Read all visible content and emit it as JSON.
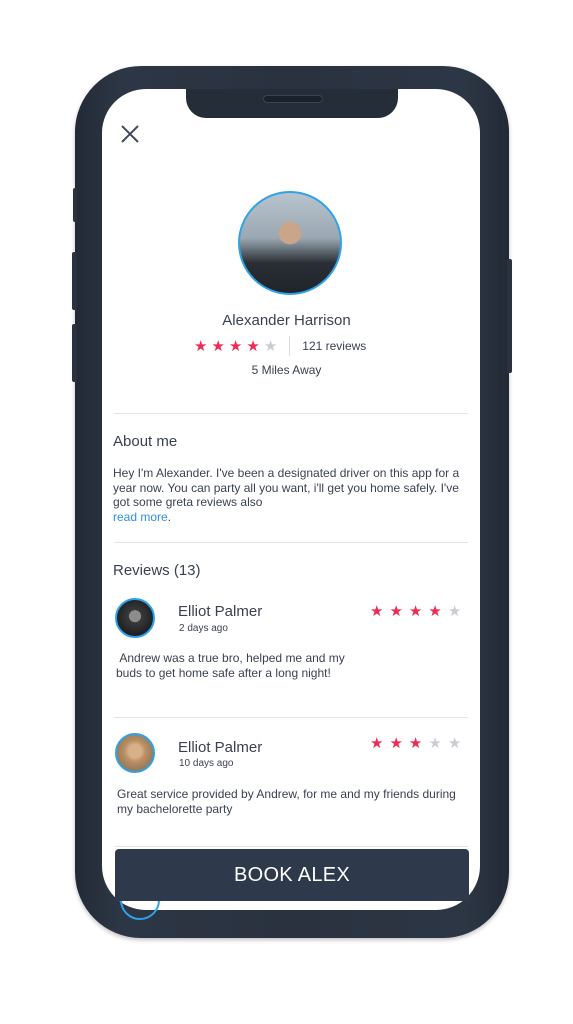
{
  "profile": {
    "name": "Alexander Harrison",
    "rating": 4,
    "rating_max": 5,
    "review_count_label": "121 reviews",
    "distance": "5 Miles Away"
  },
  "about": {
    "title": "About me",
    "text": "Hey I'm Alexander. I've been a designated driver on this app for a year now. You can party all you want, i'll get you home safely. I've got some greta reviews also",
    "read_more": "read more",
    "read_more_suffix": "."
  },
  "reviews": {
    "title": "Reviews (13)",
    "items": [
      {
        "name": "Elliot Palmer",
        "date": "2 days ago",
        "rating": 4,
        "text": " Andrew was a true bro, helped me and my buds to get home safe after a long night!"
      },
      {
        "name": "Elliot Palmer",
        "date": "10 days ago",
        "rating": 3,
        "text": "Great service provided by Andrew, for me and my friends during my bachelorette party"
      }
    ]
  },
  "actions": {
    "close_icon": "close-icon",
    "book_label": "BOOK ALEX"
  },
  "colors": {
    "star_on": "#ee2a55",
    "star_off": "#c9cdd3",
    "accent_blue": "#2fa3e6",
    "link": "#2f8fe0",
    "button_bg": "#2e3a4b",
    "text": "#3a4150"
  }
}
